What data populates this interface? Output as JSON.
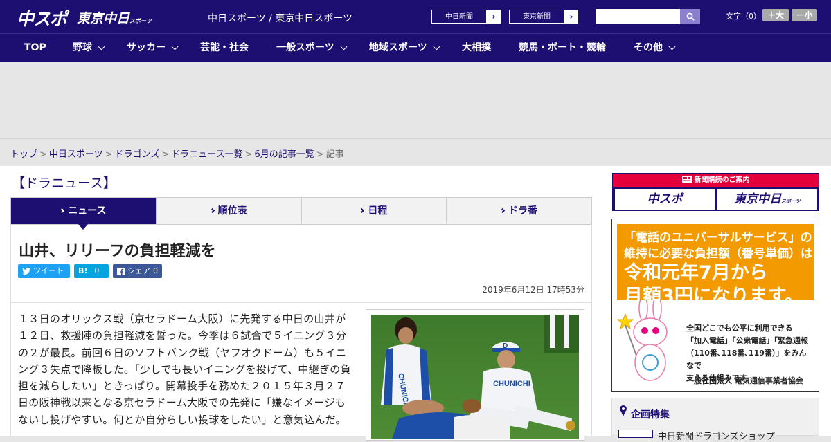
{
  "header": {
    "logo_main": "中スポ",
    "logo_tokyo": "東京中日",
    "logo_tokyo_small": "スポーツ",
    "site_title": "中日スポーツ / 東京中日スポーツ",
    "ext_links": [
      "中日新聞",
      "東京新聞"
    ],
    "search_placeholder": "",
    "fontsize_label": "文字（0）",
    "font_larger": "＋大",
    "font_smaller": "－小"
  },
  "nav": {
    "items": [
      {
        "label": "TOP",
        "dropdown": false
      },
      {
        "label": "野球",
        "dropdown": true
      },
      {
        "label": "サッカー",
        "dropdown": true
      },
      {
        "label": "芸能・社会",
        "dropdown": false
      },
      {
        "label": "一般スポーツ",
        "dropdown": true
      },
      {
        "label": "地域スポーツ",
        "dropdown": true
      },
      {
        "label": "大相撲",
        "dropdown": false
      },
      {
        "label": "競馬・ボート・競輪",
        "dropdown": false
      },
      {
        "label": "その他",
        "dropdown": true
      }
    ]
  },
  "breadcrumb": {
    "links": [
      "トップ",
      "中日スポーツ",
      "ドラゴンズ",
      "ドラニュース一覧",
      "6月の記事一覧"
    ],
    "current": "記事"
  },
  "section": {
    "heading": "【ドラニュース】",
    "tabs": [
      "ニュース",
      "順位表",
      "日程",
      "ドラ番"
    ],
    "active_tab": 0
  },
  "article": {
    "title": "山井、リリーフの負担軽減を",
    "tweet_label": "ツイート",
    "hatena_label": "B!",
    "hatena_count": "0",
    "share_label": "シェア",
    "share_count": "0",
    "date": "2019年6月12日 17時53分",
    "body": "１３日のオリックス戦（京セラドーム大阪）に先発する中日の山井が１２日、救援陣の負担軽減を誓った。今季は６試合で５イニング３分の２が最長。前回６日のソフトバンク戦（ヤフオクドーム）も５イニング３失点で降板した。「少しでも長いイニングを投げて、中継ぎの負担を減らしたい」ときっぱり。開幕投手を務めた２０１５年３月２７日の阪神戦以来となる京セラドーム大阪での先発に「嫌なイメージもないし投げやすい。何とか自分らしい投球をしたい」と意気込んだ。"
  },
  "photo": {
    "jersey_text_1": "CHUNICHI",
    "jersey_text_2": "CHUNICHI",
    "cap_letter": "D"
  },
  "sidebar": {
    "subscribe_heading": "新聞購読のご案内",
    "subscribe_btn_1": "中スポ",
    "subscribe_btn_2": "東京中日",
    "subscribe_btn_2_small": "スポーツ",
    "ad_line1": "「電話のユニバーサルサービス」の",
    "ad_line2": "維持に必要な負担額（番号単価）は",
    "ad_line3": "令和元年7月から",
    "ad_line4": "月額3円になります。",
    "ad_text1": "全国どこでも公平に利用できる",
    "ad_text2": "「加入電話」「公衆電話」「緊急通報",
    "ad_text3": "（110番､118番､119番）」をみんなで",
    "ad_text4": "支える仕組みです。",
    "ad_org": "一般社団法人 電気通信事業者協会",
    "feature_title": "企画特集",
    "feature_item": "中日新聞ドラゴンズショップ"
  },
  "colors": {
    "brand": "#1d0e72",
    "accent_red": "#e6003b",
    "ad_orange": "#f39a00",
    "twitter": "#1da1f2",
    "hatena": "#00a4de",
    "facebook": "#3b5998"
  }
}
